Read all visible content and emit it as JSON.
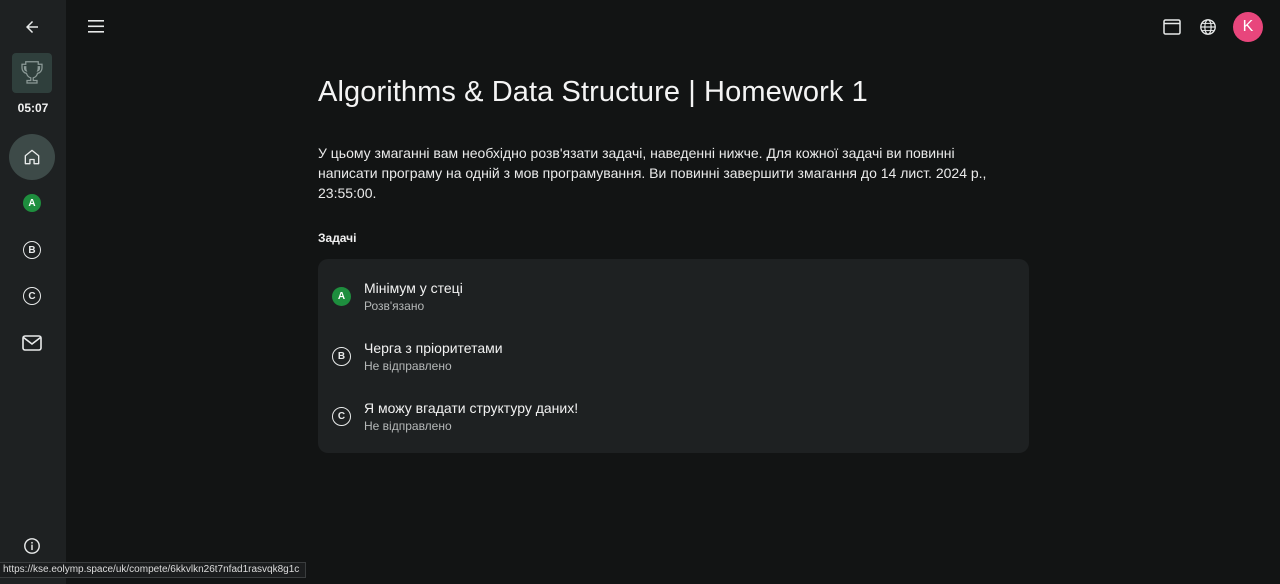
{
  "timer": "05:07",
  "page": {
    "title": "Algorithms & Data Structure | Homework 1",
    "description": "У цьому змаганні вам необхідно розв'язати задачі, наведенні нижче. Для кожної задачі ви повинні написати програму на одній з мов програмування. Ви повинні завершити змагання до 14 лист. 2024 р., 23:55:00.",
    "problems_label": "Задачі"
  },
  "sidebar": {
    "problems": [
      {
        "letter": "A",
        "solved": true
      },
      {
        "letter": "B",
        "solved": false
      },
      {
        "letter": "C",
        "solved": false
      }
    ]
  },
  "problems": [
    {
      "letter": "A",
      "name": "Мінімум у стеці",
      "status": "Розв'язано",
      "solved": true
    },
    {
      "letter": "B",
      "name": "Черга з пріоритетами",
      "status": "Не відправлено",
      "solved": false
    },
    {
      "letter": "C",
      "name": "Я можу вгадати структуру даних!",
      "status": "Не відправлено",
      "solved": false
    }
  ],
  "avatar_letter": "K",
  "status_url": "https://kse.eolymp.space/uk/compete/6kkvlkn26t7nfad1rasvqk8g1c",
  "colors": {
    "background": "#121414",
    "sidebar": "#1e2122",
    "card": "#1e2122",
    "solved": "#1e8e3e",
    "avatar": "#e8467c"
  },
  "icons": {
    "back": "arrow-left-icon",
    "trophy": "trophy-icon",
    "home": "home-icon",
    "mail": "mail-icon",
    "info": "info-icon",
    "menu": "hamburger-menu-icon",
    "window": "window-icon",
    "globe": "globe-icon"
  }
}
